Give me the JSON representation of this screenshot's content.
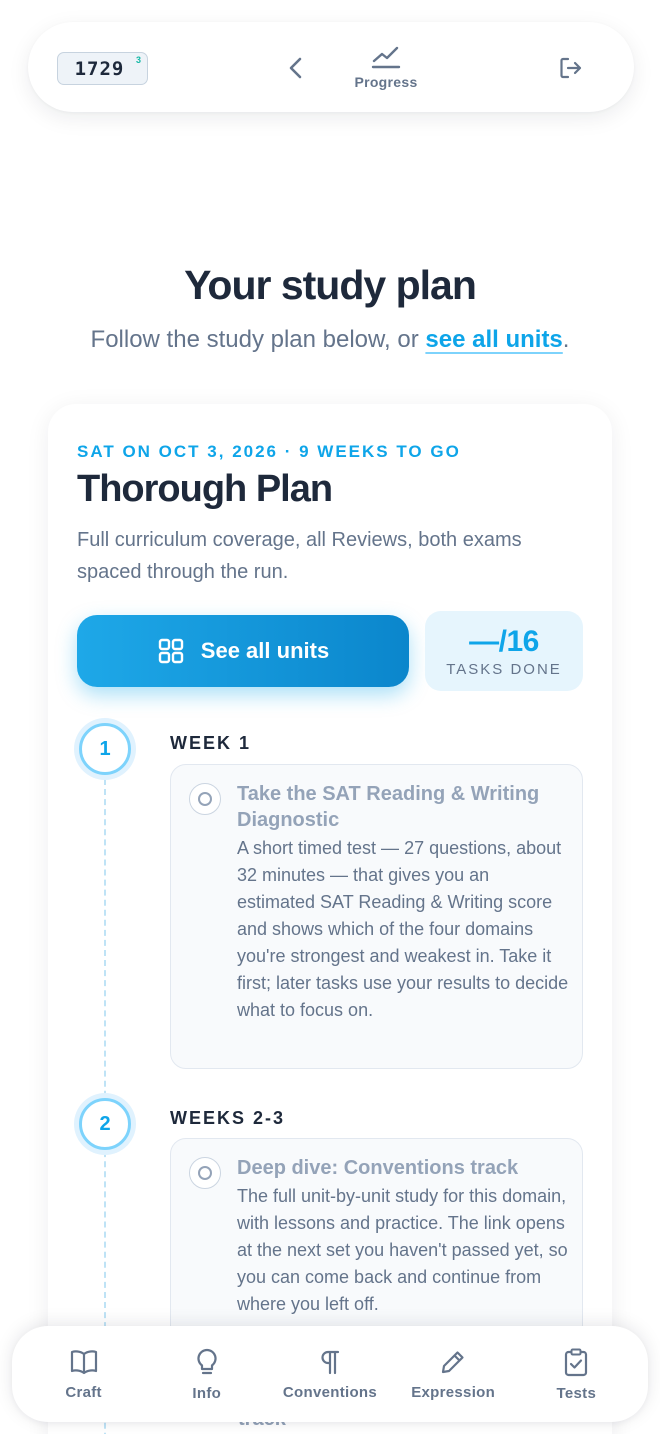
{
  "topbar": {
    "score": "1729",
    "score_sup": "3",
    "progress_label": "Progress",
    "icons": [
      "chevron-left-icon",
      "trend-line-icon",
      "logout-icon"
    ]
  },
  "header": {
    "title": "Your study plan",
    "subtitle_prefix": "Follow the study plan below, or ",
    "subtitle_link": "see all units",
    "subtitle_suffix": "."
  },
  "plan": {
    "meta": "SAT ON OCT 3, 2026 · 9 WEEKS TO GO",
    "title": "Thorough Plan",
    "description": "Full curriculum coverage, all Reviews, both exams spaced through the run.",
    "see_all_label": "See all units",
    "tasks_count": "—/16",
    "tasks_label": "TASKS DONE"
  },
  "weeks": [
    {
      "number": "1",
      "label": "WEEK 1",
      "task": {
        "title": "Take the SAT Reading & Writing Diagnostic",
        "description": "A short timed test — 27 questions, about 32 minutes — that gives you an estimated SAT Reading & Writing score and shows which of the four domains you're strongest and weakest in. Take it first; later tasks use your results to decide what to focus on."
      }
    },
    {
      "number": "2",
      "label": "WEEKS 2-3",
      "task": {
        "title": "Deep dive: Conventions track",
        "description": "The full unit-by-unit study for this domain, with lessons and practice. The link opens at the next set you haven't passed yet, so you can come back and continue from where you left off."
      }
    }
  ],
  "peek_text": "track",
  "bottom_nav": [
    {
      "label": "Craft",
      "icon": "book-open-icon"
    },
    {
      "label": "Info",
      "icon": "lightbulb-icon"
    },
    {
      "label": "Conventions",
      "icon": "pilcrow-icon"
    },
    {
      "label": "Expression",
      "icon": "pencil-icon"
    },
    {
      "label": "Tests",
      "icon": "clipboard-check-icon"
    }
  ],
  "colors": {
    "accent": "#0ea5e9",
    "text": "#1e293b",
    "muted": "#64748b"
  }
}
